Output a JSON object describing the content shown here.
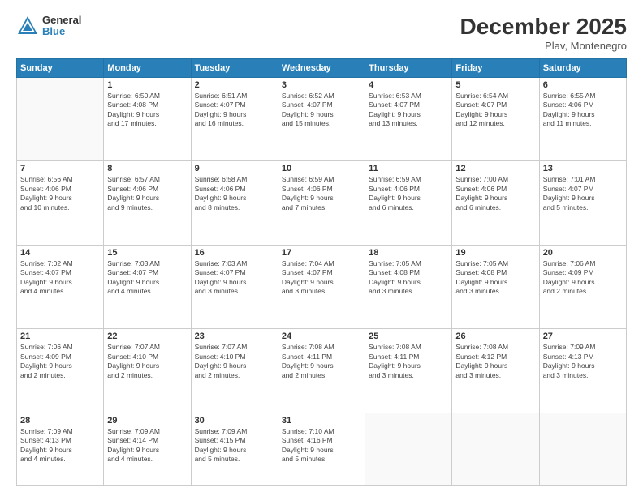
{
  "header": {
    "logo_general": "General",
    "logo_blue": "Blue",
    "month_title": "December 2025",
    "location": "Plav, Montenegro"
  },
  "days_of_week": [
    "Sunday",
    "Monday",
    "Tuesday",
    "Wednesday",
    "Thursday",
    "Friday",
    "Saturday"
  ],
  "weeks": [
    [
      {
        "day": "",
        "info": ""
      },
      {
        "day": "1",
        "info": "Sunrise: 6:50 AM\nSunset: 4:08 PM\nDaylight: 9 hours\nand 17 minutes."
      },
      {
        "day": "2",
        "info": "Sunrise: 6:51 AM\nSunset: 4:07 PM\nDaylight: 9 hours\nand 16 minutes."
      },
      {
        "day": "3",
        "info": "Sunrise: 6:52 AM\nSunset: 4:07 PM\nDaylight: 9 hours\nand 15 minutes."
      },
      {
        "day": "4",
        "info": "Sunrise: 6:53 AM\nSunset: 4:07 PM\nDaylight: 9 hours\nand 13 minutes."
      },
      {
        "day": "5",
        "info": "Sunrise: 6:54 AM\nSunset: 4:07 PM\nDaylight: 9 hours\nand 12 minutes."
      },
      {
        "day": "6",
        "info": "Sunrise: 6:55 AM\nSunset: 4:06 PM\nDaylight: 9 hours\nand 11 minutes."
      }
    ],
    [
      {
        "day": "7",
        "info": "Sunrise: 6:56 AM\nSunset: 4:06 PM\nDaylight: 9 hours\nand 10 minutes."
      },
      {
        "day": "8",
        "info": "Sunrise: 6:57 AM\nSunset: 4:06 PM\nDaylight: 9 hours\nand 9 minutes."
      },
      {
        "day": "9",
        "info": "Sunrise: 6:58 AM\nSunset: 4:06 PM\nDaylight: 9 hours\nand 8 minutes."
      },
      {
        "day": "10",
        "info": "Sunrise: 6:59 AM\nSunset: 4:06 PM\nDaylight: 9 hours\nand 7 minutes."
      },
      {
        "day": "11",
        "info": "Sunrise: 6:59 AM\nSunset: 4:06 PM\nDaylight: 9 hours\nand 6 minutes."
      },
      {
        "day": "12",
        "info": "Sunrise: 7:00 AM\nSunset: 4:06 PM\nDaylight: 9 hours\nand 6 minutes."
      },
      {
        "day": "13",
        "info": "Sunrise: 7:01 AM\nSunset: 4:07 PM\nDaylight: 9 hours\nand 5 minutes."
      }
    ],
    [
      {
        "day": "14",
        "info": "Sunrise: 7:02 AM\nSunset: 4:07 PM\nDaylight: 9 hours\nand 4 minutes."
      },
      {
        "day": "15",
        "info": "Sunrise: 7:03 AM\nSunset: 4:07 PM\nDaylight: 9 hours\nand 4 minutes."
      },
      {
        "day": "16",
        "info": "Sunrise: 7:03 AM\nSunset: 4:07 PM\nDaylight: 9 hours\nand 3 minutes."
      },
      {
        "day": "17",
        "info": "Sunrise: 7:04 AM\nSunset: 4:07 PM\nDaylight: 9 hours\nand 3 minutes."
      },
      {
        "day": "18",
        "info": "Sunrise: 7:05 AM\nSunset: 4:08 PM\nDaylight: 9 hours\nand 3 minutes."
      },
      {
        "day": "19",
        "info": "Sunrise: 7:05 AM\nSunset: 4:08 PM\nDaylight: 9 hours\nand 3 minutes."
      },
      {
        "day": "20",
        "info": "Sunrise: 7:06 AM\nSunset: 4:09 PM\nDaylight: 9 hours\nand 2 minutes."
      }
    ],
    [
      {
        "day": "21",
        "info": "Sunrise: 7:06 AM\nSunset: 4:09 PM\nDaylight: 9 hours\nand 2 minutes."
      },
      {
        "day": "22",
        "info": "Sunrise: 7:07 AM\nSunset: 4:10 PM\nDaylight: 9 hours\nand 2 minutes."
      },
      {
        "day": "23",
        "info": "Sunrise: 7:07 AM\nSunset: 4:10 PM\nDaylight: 9 hours\nand 2 minutes."
      },
      {
        "day": "24",
        "info": "Sunrise: 7:08 AM\nSunset: 4:11 PM\nDaylight: 9 hours\nand 2 minutes."
      },
      {
        "day": "25",
        "info": "Sunrise: 7:08 AM\nSunset: 4:11 PM\nDaylight: 9 hours\nand 3 minutes."
      },
      {
        "day": "26",
        "info": "Sunrise: 7:08 AM\nSunset: 4:12 PM\nDaylight: 9 hours\nand 3 minutes."
      },
      {
        "day": "27",
        "info": "Sunrise: 7:09 AM\nSunset: 4:13 PM\nDaylight: 9 hours\nand 3 minutes."
      }
    ],
    [
      {
        "day": "28",
        "info": "Sunrise: 7:09 AM\nSunset: 4:13 PM\nDaylight: 9 hours\nand 4 minutes."
      },
      {
        "day": "29",
        "info": "Sunrise: 7:09 AM\nSunset: 4:14 PM\nDaylight: 9 hours\nand 4 minutes."
      },
      {
        "day": "30",
        "info": "Sunrise: 7:09 AM\nSunset: 4:15 PM\nDaylight: 9 hours\nand 5 minutes."
      },
      {
        "day": "31",
        "info": "Sunrise: 7:10 AM\nSunset: 4:16 PM\nDaylight: 9 hours\nand 5 minutes."
      },
      {
        "day": "",
        "info": ""
      },
      {
        "day": "",
        "info": ""
      },
      {
        "day": "",
        "info": ""
      }
    ]
  ]
}
